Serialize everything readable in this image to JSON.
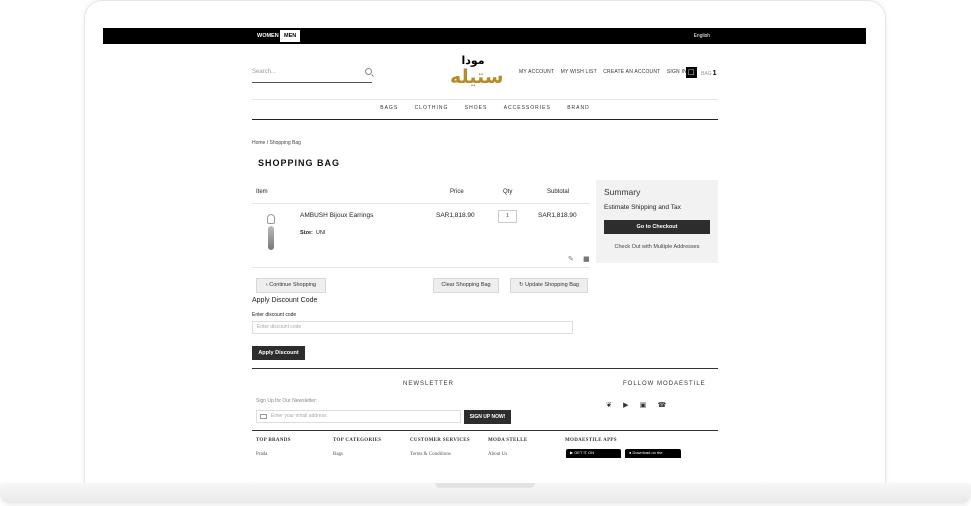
{
  "topbar": {
    "women": "WOMEN",
    "men": "MEN",
    "language": "English"
  },
  "header": {
    "search_placeholder": "Search...",
    "logo_line1": "مودا",
    "logo_line2": "ستيله",
    "links": [
      "MY ACCOUNT",
      "MY WISH LIST",
      "CREATE AN ACCOUNT",
      "SIGN IN"
    ],
    "bag_label": "BAG",
    "bag_count": "1"
  },
  "nav": [
    "BAGS",
    "CLOTHING",
    "SHOES",
    "ACCESSORIES",
    "BRAND"
  ],
  "breadcrumb": "Home / Shopping Bag",
  "page_title": "SHOPPING BAG",
  "table": {
    "headers": {
      "item": "Item",
      "price": "Price",
      "qty": "Qty",
      "subtotal": "Subtotal"
    },
    "rows": [
      {
        "name": "AMBUSH Bijoux Earrings",
        "size_label": "Size:",
        "size": "UNI",
        "price": "SAR1,818.90",
        "qty": "1",
        "subtotal": "SAR1,818.90"
      }
    ]
  },
  "buttons": {
    "continue": "Continue Shopping",
    "clear": "Clear Shopping Bag",
    "update": "Update Shopping Bag",
    "apply": "Apply Discount"
  },
  "discount": {
    "title": "Apply Discount Code",
    "label": "Enter discount code",
    "placeholder": "Enter discount code"
  },
  "summary": {
    "title": "Summary",
    "estimate": "Estimate Shipping and Tax",
    "checkout": "Go to Checkout",
    "multi": "Check Out with Multiple Addresses"
  },
  "newsletter": {
    "title": "NEWSLETTER",
    "subtitle": "Sign Up for Our Newsletter:",
    "placeholder": "Enter your email address",
    "button": "SIGN UP NOW!"
  },
  "follow": {
    "title": "FOLLOW MODAESTILE"
  },
  "footer": {
    "cols": [
      {
        "heading": "TOP BRANDS",
        "first": "Prada"
      },
      {
        "heading": "TOP CATEGORIES",
        "first": "Bags"
      },
      {
        "heading": "CUSTOMER SERVICES",
        "first": "Terms & Conditions"
      },
      {
        "heading": "MODA STELLE",
        "first": "About Us"
      },
      {
        "heading": "MODAESTILE APPS",
        "first": ""
      }
    ],
    "stores": [
      "GET IT ON",
      "Download on the"
    ]
  }
}
